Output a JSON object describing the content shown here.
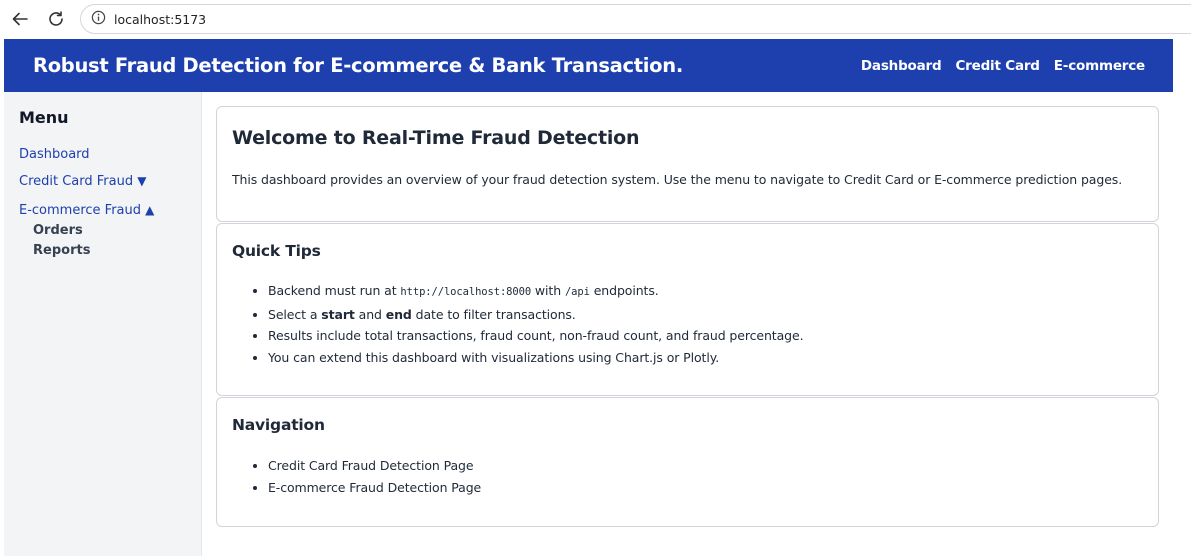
{
  "browser": {
    "url": "localhost:5173"
  },
  "header": {
    "title": "Robust Fraud Detection for E-commerce & Bank Transaction.",
    "nav": [
      "Dashboard",
      "Credit Card",
      "E-commerce"
    ]
  },
  "sidebar": {
    "heading": "Menu",
    "dashboard": "Dashboard",
    "credit_card": "Credit Card Fraud",
    "credit_card_arrow": "▼",
    "ecommerce": "E-commerce Fraud",
    "ecommerce_arrow": "▲",
    "ecommerce_sub": [
      "Orders",
      "Reports"
    ]
  },
  "welcome": {
    "title": "Welcome to Real-Time Fraud Detection",
    "text": "This dashboard provides an overview of your fraud detection system. Use the menu to navigate to Credit Card or E-commerce prediction pages."
  },
  "tips": {
    "title": "Quick Tips",
    "tip1_pre": "Backend must run at ",
    "tip1_code1": "http://localhost:8000",
    "tip1_mid": " with ",
    "tip1_code2": "/api",
    "tip1_post": " endpoints.",
    "tip2_pre": "Select a ",
    "tip2_b1": "start",
    "tip2_mid": " and ",
    "tip2_b2": "end",
    "tip2_post": " date to filter transactions.",
    "tip3": "Results include total transactions, fraud count, non-fraud count, and fraud percentage.",
    "tip4": "You can extend this dashboard with visualizations using Chart.js or Plotly."
  },
  "navigation": {
    "title": "Navigation",
    "items": [
      "Credit Card Fraud Detection Page",
      "E-commerce Fraud Detection Page"
    ]
  },
  "colors": {
    "header_bg": "#1e40af",
    "link": "#1e40af",
    "sidebar_bg": "#f3f4f6"
  }
}
